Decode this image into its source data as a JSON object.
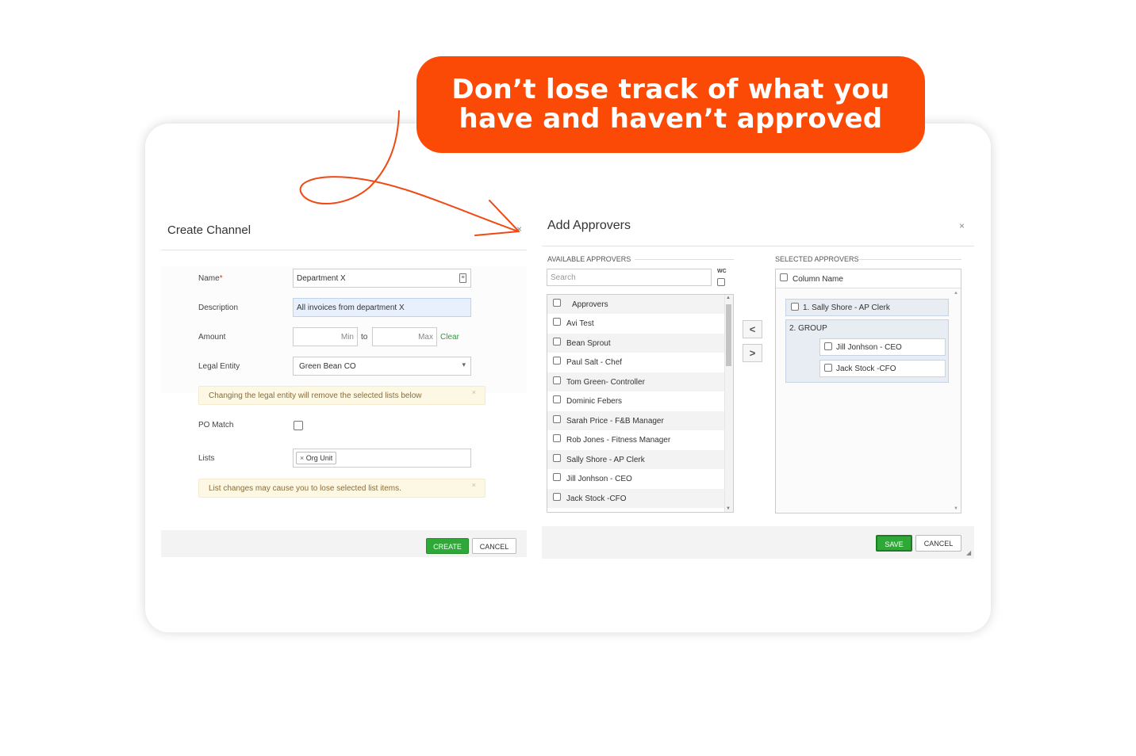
{
  "banner": {
    "line1": "Don’t lose track of what you",
    "line2": "have and haven’t approved"
  },
  "create_channel": {
    "title": "Create Channel",
    "close": "×",
    "name_label": "Name",
    "required_mark": "*",
    "name_value": "Department X",
    "description_label": "Description",
    "description_value": "All invoices from department X",
    "amount_label": "Amount",
    "min_placeholder": "Min",
    "to_text": "to",
    "max_placeholder": "Max",
    "clear_link": "Clear",
    "legal_entity_label": "Legal Entity",
    "legal_entity_value": "Green Bean CO",
    "legal_entity_warning": "Changing the legal entity will remove the selected lists below",
    "po_match_label": "PO Match",
    "lists_label": "Lists",
    "lists_chip": "Org Unit",
    "lists_warning": "List changes may cause you to lose selected list items.",
    "create_button": "CREATE",
    "cancel_button": "CANCEL"
  },
  "add_approvers": {
    "title": "Add Approvers",
    "close": "×",
    "available_label": "AVAILABLE APPROVERS",
    "search_placeholder": "Search",
    "wc_label": "WC",
    "available": [
      "Approvers",
      "Avi Test",
      "Bean Sprout",
      "Paul Salt - Chef",
      "Tom Green- Controller",
      "Dominic Febers",
      "Sarah Price - F&B Manager",
      "Rob Jones - Fitness Manager",
      "Sally Shore - AP Clerk",
      "Jill Jonhson - CEO",
      "Jack Stock -CFO"
    ],
    "move_left": "<",
    "move_right": ">",
    "selected_label": "SELECTED APPROVERS",
    "column_name": "Column Name",
    "selected_1": "1. Sally Shore - AP Clerk",
    "group_label": "2. GROUP",
    "group_members": [
      "Jill Jonhson - CEO",
      "Jack Stock -CFO"
    ],
    "save_button": "SAVE",
    "cancel_button": "CANCEL"
  },
  "colors": {
    "banner": "#fa4a05",
    "accent_green": "#2ea836",
    "arrow": "#f04a14"
  }
}
